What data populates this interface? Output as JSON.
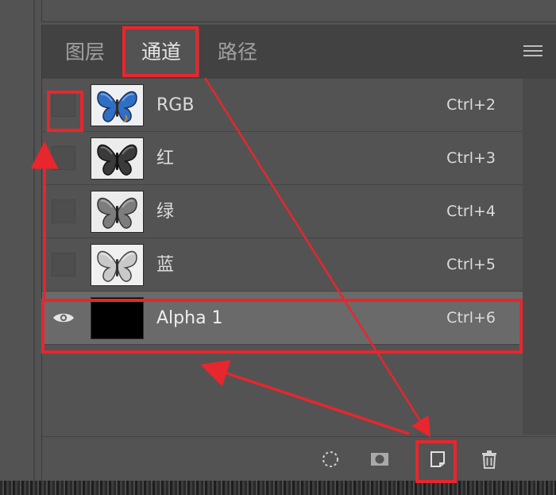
{
  "panel": {
    "tabs": [
      {
        "label": "图层",
        "active": false
      },
      {
        "label": "通道",
        "active": true
      },
      {
        "label": "路径",
        "active": false
      }
    ],
    "menu_icon": "hamburger-menu-icon"
  },
  "channels": [
    {
      "name": "RGB",
      "shortcut": "Ctrl+2",
      "visible": false,
      "selected": false,
      "thumbnail": "butterfly-color"
    },
    {
      "name": "红",
      "shortcut": "Ctrl+3",
      "visible": false,
      "selected": false,
      "thumbnail": "butterfly-grayscale-dark"
    },
    {
      "name": "绿",
      "shortcut": "Ctrl+4",
      "visible": false,
      "selected": false,
      "thumbnail": "butterfly-grayscale-mid"
    },
    {
      "name": "蓝",
      "shortcut": "Ctrl+5",
      "visible": false,
      "selected": false,
      "thumbnail": "butterfly-grayscale-light"
    },
    {
      "name": "Alpha 1",
      "shortcut": "Ctrl+6",
      "visible": true,
      "selected": true,
      "thumbnail": "black"
    }
  ],
  "footer": {
    "icons": [
      "load-selection-icon",
      "save-selection-icon",
      "new-channel-icon",
      "delete-channel-icon"
    ]
  },
  "annotations": {
    "highlight_color": "#e8262d",
    "arrow_color": "#e8262d"
  },
  "colors": {
    "panel_bg": "#535353",
    "tabbar_bg": "#424242",
    "selected_row_bg": "#6a6a6a"
  }
}
